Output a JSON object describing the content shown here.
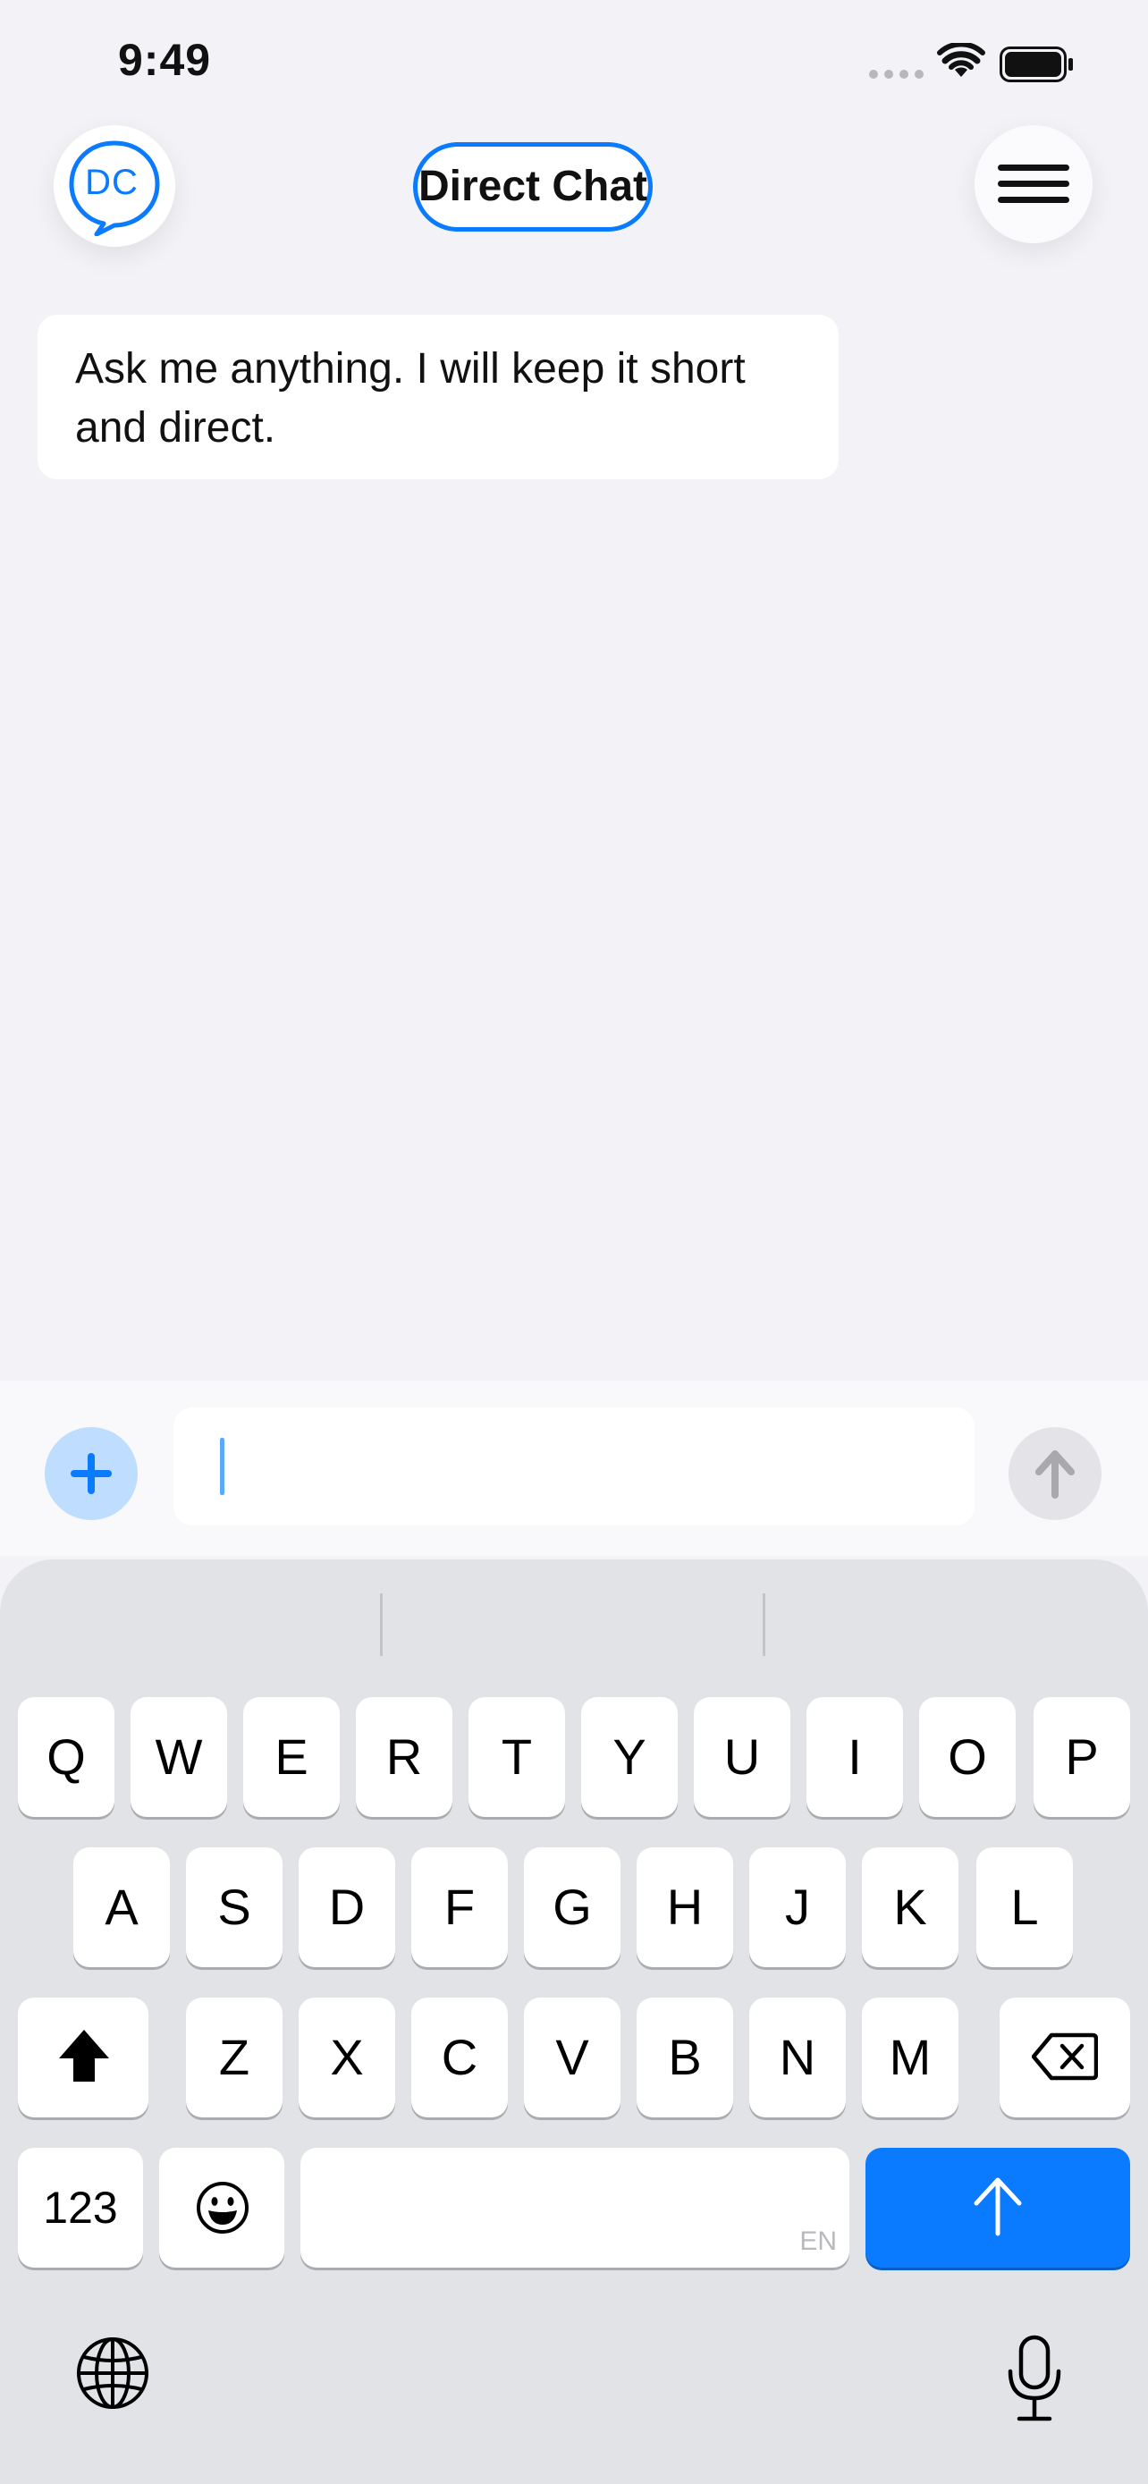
{
  "status_bar": {
    "time": "9:49"
  },
  "header": {
    "avatar_initials": "DC",
    "title": "Direct Chat"
  },
  "messages": [
    {
      "role": "assistant",
      "text": "Ask me anything. I will keep it short and direct."
    }
  ],
  "composer": {
    "input_value": "",
    "input_placeholder": ""
  },
  "keyboard": {
    "row1": [
      "Q",
      "W",
      "E",
      "R",
      "T",
      "Y",
      "U",
      "I",
      "O",
      "P"
    ],
    "row2": [
      "A",
      "S",
      "D",
      "F",
      "G",
      "H",
      "J",
      "K",
      "L"
    ],
    "row3": [
      "Z",
      "X",
      "C",
      "V",
      "B",
      "N",
      "M"
    ],
    "numbers_key": "123",
    "space_language": "EN"
  },
  "colors": {
    "accent": "#0a7aff",
    "background": "#f2f2f7",
    "keyboard_bg": "#e2e3e7",
    "attach_button_bg": "#bfdeff",
    "send_button_disabled_bg": "#e4e4e8"
  },
  "icons": {
    "avatar": "speech-bubble-icon",
    "menu": "hamburger-menu-icon",
    "attach": "plus-icon",
    "send": "arrow-up-icon",
    "shift": "shift-icon",
    "delete": "backspace-icon",
    "emoji": "emoji-icon",
    "return": "arrow-up-icon",
    "globe": "globe-icon",
    "dictation": "microphone-icon",
    "wifi": "wifi-icon",
    "battery": "battery-icon",
    "signal": "cellular-signal-icon"
  }
}
